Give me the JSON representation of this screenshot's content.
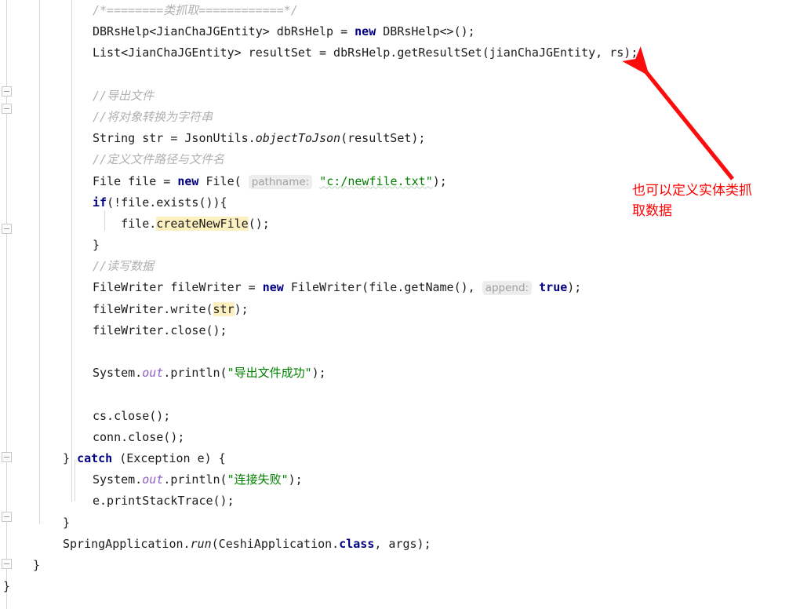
{
  "app": {
    "type": "code-editor",
    "language": "Java"
  },
  "colors": {
    "keyword": "#000080",
    "comment": "#b0b0b0",
    "string": "#008000",
    "static_field": "#8c5ec1",
    "search_highlight": "#fdf0c0",
    "param_hint_bg": "#ededed",
    "param_hint_text": "#a0a0a0",
    "annotation_red": "#ff0000",
    "background": "#ffffff",
    "text": "#1c1c1c",
    "indent_guide": "#d9d9d9",
    "fold_rail": "#d8d8d8"
  },
  "gutter": {
    "fold_markers": [
      "fold-marker-1",
      "fold-marker-2",
      "fold-marker-3",
      "fold-marker-4",
      "fold-marker-5",
      "fold-marker-6"
    ]
  },
  "code": {
    "lines": [
      {
        "id": "line-1",
        "indent": 118,
        "segments": [
          {
            "cls": "cmt",
            "t": "/*========类抓取============*/"
          }
        ]
      },
      {
        "id": "line-2",
        "indent": 118,
        "segments": [
          {
            "cls": "plain",
            "t": "DBRsHelp<JianChaJGEntity> dbRsHelp = "
          },
          {
            "cls": "kw",
            "t": "new"
          },
          {
            "cls": "plain",
            "t": " DBRsHelp<>();"
          }
        ]
      },
      {
        "id": "line-3",
        "indent": 118,
        "segments": [
          {
            "cls": "plain",
            "t": "List<JianChaJGEntity> resultSet = dbRsHelp.getResultSet(jianChaJGEntity, rs);"
          }
        ]
      },
      {
        "id": "line-4",
        "indent": 118,
        "segments": [
          {
            "cls": "plain",
            "t": ""
          }
        ]
      },
      {
        "id": "line-5",
        "indent": 118,
        "segments": [
          {
            "cls": "cmt",
            "t": "//导出文件"
          }
        ]
      },
      {
        "id": "line-6",
        "indent": 118,
        "segments": [
          {
            "cls": "cmt",
            "t": "//将对象转换为字符串"
          }
        ]
      },
      {
        "id": "line-7",
        "indent": 118,
        "segments": [
          {
            "cls": "plain",
            "t": "String str = JsonUtils."
          },
          {
            "cls": "mitalic",
            "t": "objectToJson"
          },
          {
            "cls": "plain",
            "t": "(resultSet);"
          }
        ]
      },
      {
        "id": "line-8",
        "indent": 118,
        "segments": [
          {
            "cls": "cmt",
            "t": "//定义文件路径与文件名"
          }
        ]
      },
      {
        "id": "line-9",
        "indent": 118,
        "segments": [
          {
            "cls": "plain",
            "t": "File file = "
          },
          {
            "cls": "kw",
            "t": "new"
          },
          {
            "cls": "plain",
            "t": " File( "
          },
          {
            "cls": "hint",
            "t": "pathname:"
          },
          {
            "cls": "plain",
            "t": " "
          },
          {
            "cls": "strz",
            "t": "\"c:/newfile.txt\""
          },
          {
            "cls": "plain",
            "t": ");"
          }
        ]
      },
      {
        "id": "line-10",
        "indent": 118,
        "segments": [
          {
            "cls": "kw",
            "t": "if"
          },
          {
            "cls": "plain",
            "t": "(!file.exists()){"
          }
        ]
      },
      {
        "id": "line-11",
        "indent": 118,
        "segments": [
          {
            "cls": "plain",
            "t": "    file."
          },
          {
            "cls": "hl",
            "t": "createNewFile"
          },
          {
            "cls": "plain",
            "t": "();"
          }
        ]
      },
      {
        "id": "line-12",
        "indent": 118,
        "segments": [
          {
            "cls": "plain",
            "t": "}"
          }
        ]
      },
      {
        "id": "line-13",
        "indent": 118,
        "segments": [
          {
            "cls": "cmt",
            "t": "//读写数据"
          }
        ]
      },
      {
        "id": "line-14",
        "indent": 118,
        "segments": [
          {
            "cls": "plain",
            "t": "FileWriter fileWriter = "
          },
          {
            "cls": "kw",
            "t": "new"
          },
          {
            "cls": "plain",
            "t": " FileWriter(file.getName(), "
          },
          {
            "cls": "hint",
            "t": "append:"
          },
          {
            "cls": "plain",
            "t": " "
          },
          {
            "cls": "kw",
            "t": "true"
          },
          {
            "cls": "plain",
            "t": ");"
          }
        ]
      },
      {
        "id": "line-15",
        "indent": 118,
        "segments": [
          {
            "cls": "plain",
            "t": "fileWriter.write("
          },
          {
            "cls": "hl",
            "t": "str"
          },
          {
            "cls": "plain",
            "t": ");"
          }
        ]
      },
      {
        "id": "line-16",
        "indent": 118,
        "segments": [
          {
            "cls": "plain",
            "t": "fileWriter.close();"
          }
        ]
      },
      {
        "id": "line-17",
        "indent": 118,
        "segments": [
          {
            "cls": "plain",
            "t": ""
          }
        ]
      },
      {
        "id": "line-18",
        "indent": 118,
        "segments": [
          {
            "cls": "plain",
            "t": "System."
          },
          {
            "cls": "stat",
            "t": "out"
          },
          {
            "cls": "plain",
            "t": ".println("
          },
          {
            "cls": "str",
            "t": "\"导出文件成功\""
          },
          {
            "cls": "plain",
            "t": ");"
          }
        ]
      },
      {
        "id": "line-19",
        "indent": 118,
        "segments": [
          {
            "cls": "plain",
            "t": ""
          }
        ]
      },
      {
        "id": "line-20",
        "indent": 118,
        "segments": [
          {
            "cls": "plain",
            "t": "cs.close();"
          }
        ]
      },
      {
        "id": "line-21",
        "indent": 118,
        "segments": [
          {
            "cls": "plain",
            "t": "conn.close();"
          }
        ]
      },
      {
        "id": "line-22",
        "indent": 80,
        "segments": [
          {
            "cls": "plain",
            "t": "} "
          },
          {
            "cls": "kw",
            "t": "catch"
          },
          {
            "cls": "plain",
            "t": " (Exception e) {"
          }
        ]
      },
      {
        "id": "line-23",
        "indent": 118,
        "segments": [
          {
            "cls": "plain",
            "t": "System."
          },
          {
            "cls": "stat",
            "t": "out"
          },
          {
            "cls": "plain",
            "t": ".println("
          },
          {
            "cls": "str",
            "t": "\"连接失败\""
          },
          {
            "cls": "plain",
            "t": ");"
          }
        ]
      },
      {
        "id": "line-24",
        "indent": 118,
        "segments": [
          {
            "cls": "plain",
            "t": "e.printStackTrace();"
          }
        ]
      },
      {
        "id": "line-25",
        "indent": 80,
        "segments": [
          {
            "cls": "plain",
            "t": "}"
          }
        ]
      },
      {
        "id": "line-26",
        "indent": 80,
        "segments": [
          {
            "cls": "plain",
            "t": "SpringApplication."
          },
          {
            "cls": "mitalic",
            "t": "run"
          },
          {
            "cls": "plain",
            "t": "(CeshiApplication."
          },
          {
            "cls": "kw",
            "t": "class"
          },
          {
            "cls": "plain",
            "t": ", args);"
          }
        ]
      },
      {
        "id": "line-27",
        "indent": 42,
        "segments": [
          {
            "cls": "plain",
            "t": "}"
          }
        ]
      },
      {
        "id": "line-28",
        "indent": 4,
        "segments": [
          {
            "cls": "plain",
            "t": "}"
          }
        ]
      }
    ]
  },
  "annotation": {
    "arrow_label": "red-arrow",
    "text": "也可以定义实体类抓\n取数据"
  }
}
